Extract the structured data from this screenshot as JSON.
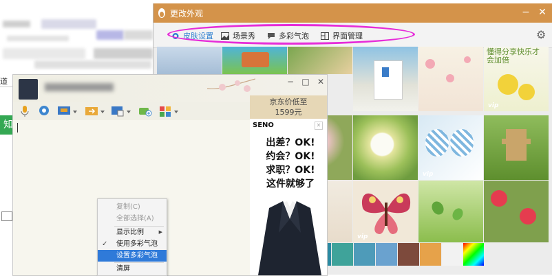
{
  "background_window": {
    "tab_label": "道",
    "green_label": "知"
  },
  "appearance_window": {
    "title": "更改外观",
    "tabs": [
      {
        "label": "皮肤设置",
        "active": true
      },
      {
        "label": "场景秀",
        "active": false
      },
      {
        "label": "多彩气泡",
        "active": false
      },
      {
        "label": "界面管理",
        "active": false
      }
    ],
    "highlight_color": "#e62cd9",
    "accent_color": "#d4934a",
    "thumbs": [
      {
        "vip": false,
        "text": ""
      },
      {
        "vip": false,
        "text": ""
      },
      {
        "vip": false,
        "text": ""
      },
      {
        "vip": false,
        "text": ""
      },
      {
        "vip": false,
        "text": ""
      },
      {
        "vip": false,
        "text": ""
      },
      {
        "vip": true,
        "text": "懂得分享快乐才会加倍"
      },
      {
        "vip": false,
        "text": ""
      },
      {
        "vip": false,
        "text": ""
      },
      {
        "vip": false,
        "text": ""
      },
      {
        "vip": true,
        "text": ""
      },
      {
        "vip": false,
        "text": ""
      },
      {
        "vip": false,
        "text": ""
      },
      {
        "vip": true,
        "text": ""
      },
      {
        "vip": false,
        "text": ""
      },
      {
        "vip": false,
        "text": ""
      }
    ],
    "vip_label": "vip",
    "swatches": [
      "#3e6fb8",
      "#2b8aa3",
      "#3fa39a",
      "#4e9bb9",
      "#6aa2cf",
      "#7d4a3c",
      "#e6a24a",
      "#f2f2f2",
      "#e84b7a"
    ]
  },
  "chat_window": {
    "ad": {
      "price_line1": "京东价低至",
      "price_line2": "1599元",
      "brand": "SENO",
      "lines": [
        "出差？OK!",
        "约会？OK!",
        "求职？OK!",
        "这件就够了"
      ]
    },
    "context_menu": {
      "items": [
        {
          "label": "复制(C)",
          "disabled": true,
          "checked": false,
          "submenu": false,
          "highlighted": false
        },
        {
          "label": "全部选择(A)",
          "disabled": true,
          "checked": false,
          "submenu": false,
          "highlighted": false
        },
        {
          "label": "显示比例",
          "disabled": false,
          "checked": false,
          "submenu": true,
          "highlighted": false
        },
        {
          "label": "使用多彩气泡",
          "disabled": false,
          "checked": true,
          "submenu": false,
          "highlighted": false
        },
        {
          "label": "设置多彩气泡",
          "disabled": false,
          "checked": false,
          "submenu": false,
          "highlighted": true
        },
        {
          "label": "清屏",
          "disabled": false,
          "checked": false,
          "submenu": false,
          "highlighted": false
        }
      ]
    }
  }
}
